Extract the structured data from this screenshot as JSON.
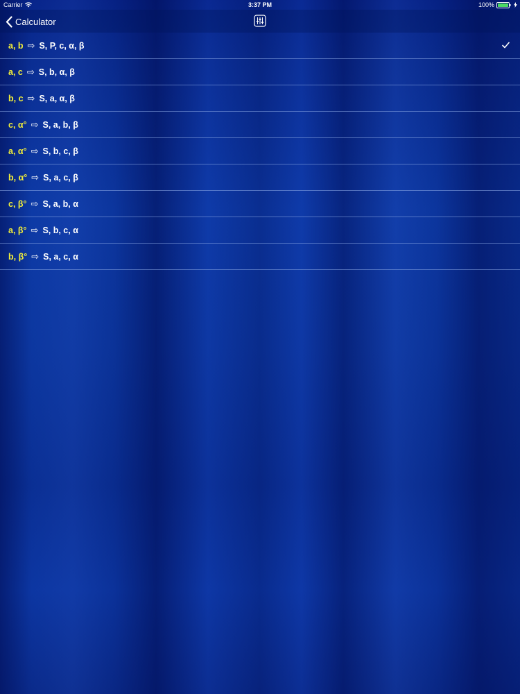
{
  "status_bar": {
    "carrier": "Carrier",
    "time": "3:37 PM",
    "battery": "100%",
    "icons": [
      "wifi-icon",
      "battery-icon",
      "charging-bolt-icon"
    ]
  },
  "nav_bar": {
    "back_label": "Calculator",
    "back_icon": "chevron-left-icon",
    "settings_icon": "sliders-icon"
  },
  "options": [
    {
      "inputs": "a, b",
      "arrow": "⇨",
      "outputs": "S, P, c, α, β",
      "selected": true
    },
    {
      "inputs": "a, c",
      "arrow": "⇨",
      "outputs": "S, b, α, β",
      "selected": false
    },
    {
      "inputs": "b, c",
      "arrow": "⇨",
      "outputs": "S, a, α, β",
      "selected": false
    },
    {
      "inputs": "c, α°",
      "arrow": "⇨",
      "outputs": "S, a, b, β",
      "selected": false
    },
    {
      "inputs": "a, α°",
      "arrow": "⇨",
      "outputs": "S, b, c, β",
      "selected": false
    },
    {
      "inputs": "b, α°",
      "arrow": "⇨",
      "outputs": "S, a, c, β",
      "selected": false
    },
    {
      "inputs": "c, β°",
      "arrow": "⇨",
      "outputs": "S, a, b, α",
      "selected": false
    },
    {
      "inputs": "a, β°",
      "arrow": "⇨",
      "outputs": "S, b, c, α",
      "selected": false
    },
    {
      "inputs": "b, β°",
      "arrow": "⇨",
      "outputs": "S, a, c, α",
      "selected": false
    }
  ],
  "colors": {
    "background": "#0b2a8c",
    "input_text": "#f2ee3a",
    "output_text": "#ffffff",
    "separator": "#8caae6"
  }
}
